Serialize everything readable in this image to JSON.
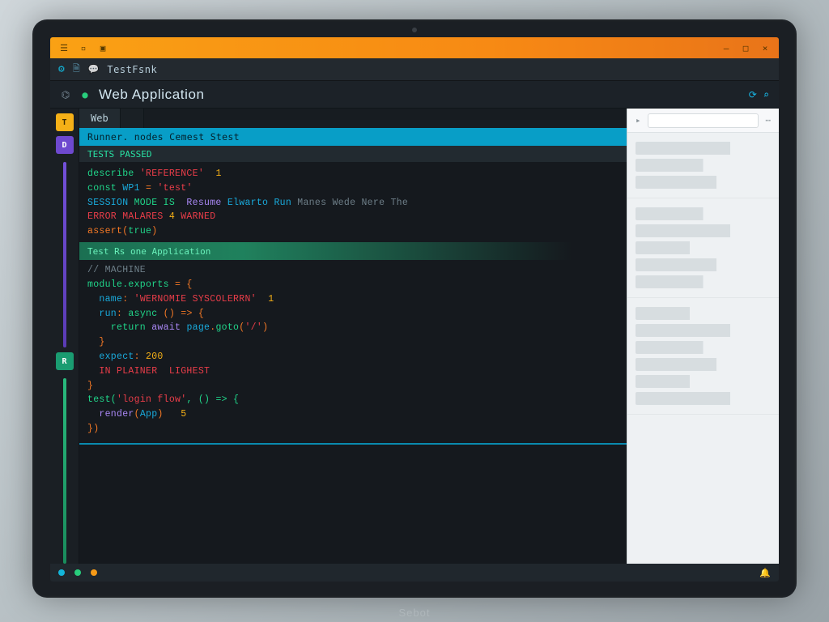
{
  "titlebar": {
    "icons": [
      "menu",
      "save",
      "open"
    ]
  },
  "toolbar": {
    "crumb": "TestFsnk"
  },
  "header": {
    "title": "Web Application"
  },
  "tabs": {
    "active": "Web",
    "inactive": ""
  },
  "banner": {
    "line1": "Runner. nodes Cemest Stest",
    "line2": "TESTS PASSED"
  },
  "code": {
    "block1": [
      {
        "cls": "tk-k",
        "txt": "describe "
      },
      {
        "cls": "tk-s",
        "txt": "'REFERENCE'  "
      },
      {
        "cls": "tk-n",
        "txt": "1"
      },
      {
        "cls2": "line",
        "parts": [
          {
            "cls": "tk-k",
            "txt": "const "
          },
          {
            "cls": "tk-t",
            "txt": "WP1 "
          },
          {
            "cls": "tk-o",
            "txt": "= "
          },
          {
            "cls": "tk-s",
            "txt": "'test'"
          }
        ]
      },
      {
        "cls2": "line",
        "parts": [
          {
            "cls": "tk-t",
            "txt": "SESSION "
          },
          {
            "cls": "tk-k",
            "txt": "MODE IS  "
          },
          {
            "cls": "tk-p",
            "txt": "Resume "
          },
          {
            "cls": "tk-t",
            "txt": "Elwarto Run "
          },
          {
            "cls": "tk-c",
            "txt": "Manes Wede Nere The "
          }
        ]
      },
      {
        "cls2": "line",
        "parts": [
          {
            "cls": "tk-s",
            "txt": "ERROR MALARES "
          },
          {
            "cls": "tk-n",
            "txt": "4 "
          },
          {
            "cls": "tk-s",
            "txt": "WARNED"
          }
        ]
      },
      {
        "cls2": "line",
        "parts": [
          {
            "cls": "tk-o",
            "txt": "assert("
          },
          {
            "cls": "tk-k",
            "txt": "true"
          },
          {
            "cls": "tk-o",
            "txt": ")"
          }
        ]
      }
    ],
    "divider": "Test Rs one Application",
    "block2": [
      {
        "cls2": "line",
        "parts": [
          {
            "cls": "tk-c",
            "txt": "// MACHINE"
          }
        ]
      },
      {
        "cls2": "line",
        "parts": [
          {
            "cls": "tk-k",
            "txt": "module.exports "
          },
          {
            "cls": "tk-o",
            "txt": "= {"
          }
        ]
      },
      {
        "cls2": "line",
        "parts": [
          {
            "cls": "tk-t",
            "txt": "  name"
          },
          {
            "cls": "tk-o",
            "txt": ": "
          },
          {
            "cls": "tk-s",
            "txt": "'WERNOMIE SYSCOLERRN'  "
          },
          {
            "cls": "tk-n",
            "txt": "1"
          }
        ]
      },
      {
        "cls2": "line",
        "parts": [
          {
            "cls": "tk-t",
            "txt": "  run"
          },
          {
            "cls": "tk-o",
            "txt": ": "
          },
          {
            "cls": "tk-k",
            "txt": "async "
          },
          {
            "cls": "tk-o",
            "txt": "() => {"
          }
        ]
      },
      {
        "cls2": "line",
        "parts": [
          {
            "cls": "tk-k",
            "txt": "    return "
          },
          {
            "cls": "tk-p",
            "txt": "await "
          },
          {
            "cls": "tk-t",
            "txt": "page"
          },
          {
            "cls": "tk-o",
            "txt": "."
          },
          {
            "cls": "tk-k",
            "txt": "goto"
          },
          {
            "cls": "tk-o",
            "txt": "("
          },
          {
            "cls": "tk-s",
            "txt": "'/'"
          },
          {
            "cls": "tk-o",
            "txt": ")"
          }
        ]
      },
      {
        "cls2": "line",
        "parts": [
          {
            "cls": "tk-o",
            "txt": "  }"
          }
        ]
      },
      {
        "cls2": "line",
        "parts": [
          {
            "cls": "tk-t",
            "txt": "  expect"
          },
          {
            "cls": "tk-o",
            "txt": ": "
          },
          {
            "cls": "tk-n",
            "txt": "200"
          }
        ]
      },
      {
        "cls2": "line",
        "parts": [
          {
            "cls": "tk-s",
            "txt": "  IN PLAINER  "
          },
          {
            "cls": "tk-s",
            "txt": "LIGHEST"
          }
        ]
      },
      {
        "cls2": "line",
        "parts": [
          {
            "cls": "tk-o",
            "txt": "}"
          }
        ]
      },
      {
        "cls2": "line",
        "parts": [
          {
            "cls": "tk-c",
            "txt": ""
          }
        ]
      },
      {
        "cls2": "line",
        "parts": [
          {
            "cls": "tk-k",
            "txt": "test("
          },
          {
            "cls": "tk-s",
            "txt": "'login flow'"
          },
          {
            "cls": "tk-k",
            "txt": ", () => {"
          }
        ]
      },
      {
        "cls2": "line",
        "parts": [
          {
            "cls": "tk-p",
            "txt": "  render"
          },
          {
            "cls": "tk-o",
            "txt": "("
          },
          {
            "cls": "tk-t",
            "txt": "App"
          },
          {
            "cls": "tk-o",
            "txt": ")   "
          },
          {
            "cls": "tk-n",
            "txt": "5"
          }
        ]
      },
      {
        "cls2": "line",
        "parts": [
          {
            "cls": "tk-o",
            "txt": "})"
          }
        ]
      }
    ]
  },
  "side": {
    "search_placeholder": ""
  },
  "brand": "Sebot"
}
